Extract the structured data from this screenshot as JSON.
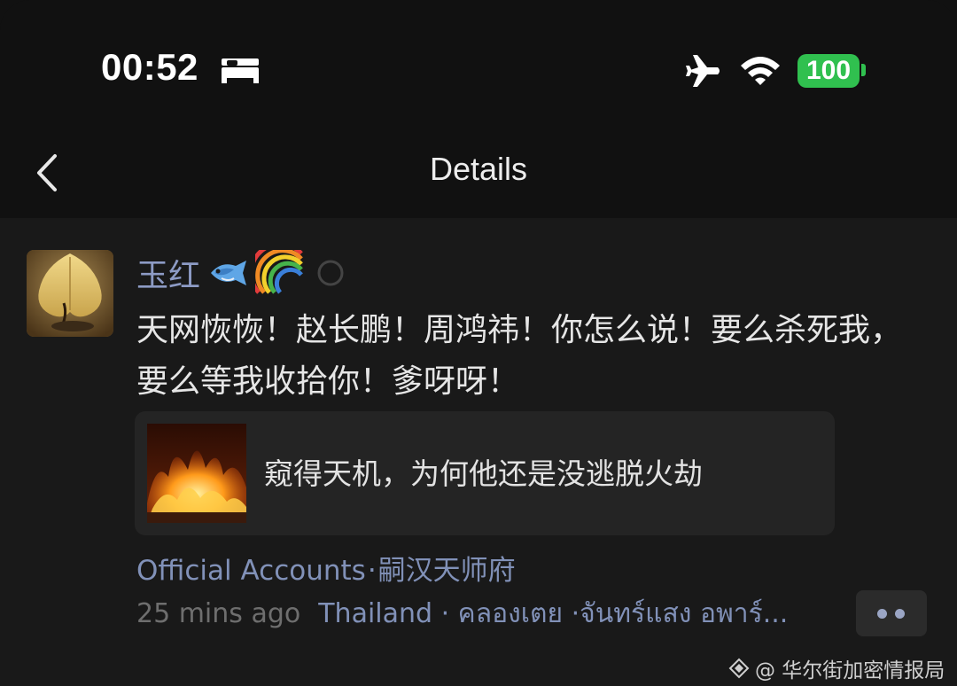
{
  "status_bar": {
    "time": "00:52",
    "icons": [
      "bed-icon",
      "airplane-icon",
      "wifi-icon",
      "battery-icon"
    ],
    "battery": "100",
    "battery_color": "#30c04f"
  },
  "nav": {
    "back_icon": "chevron-left-icon",
    "title": "Details"
  },
  "post": {
    "author": "玉红",
    "author_emojis": [
      "fish-icon",
      "rainbow-icon",
      "loading-icon"
    ],
    "text": "天网恢恢！赵长鹏！周鸿祎！你怎么说！要么杀死我，要么等我收拾你！爹呀呀！",
    "link_card": {
      "title": "窥得天机，为何他还是没逃脱火劫",
      "thumbnail_icon": "fire-image"
    },
    "source_label": "Official Accounts",
    "source_separator": "·",
    "source_name": "嗣汉天师府",
    "time": "25 mins ago",
    "location": "Thailand · คลองเตย ·จันทร์แสง อพาร์...",
    "more_icon": "more-dots-icon"
  },
  "watermark": {
    "text": "@ 华尔街加密情报局",
    "icon": "watermark-logo-icon"
  },
  "colors": {
    "background": "#111111",
    "content_background": "#191919",
    "link_color": "#8191b8",
    "card_background": "#242424"
  }
}
